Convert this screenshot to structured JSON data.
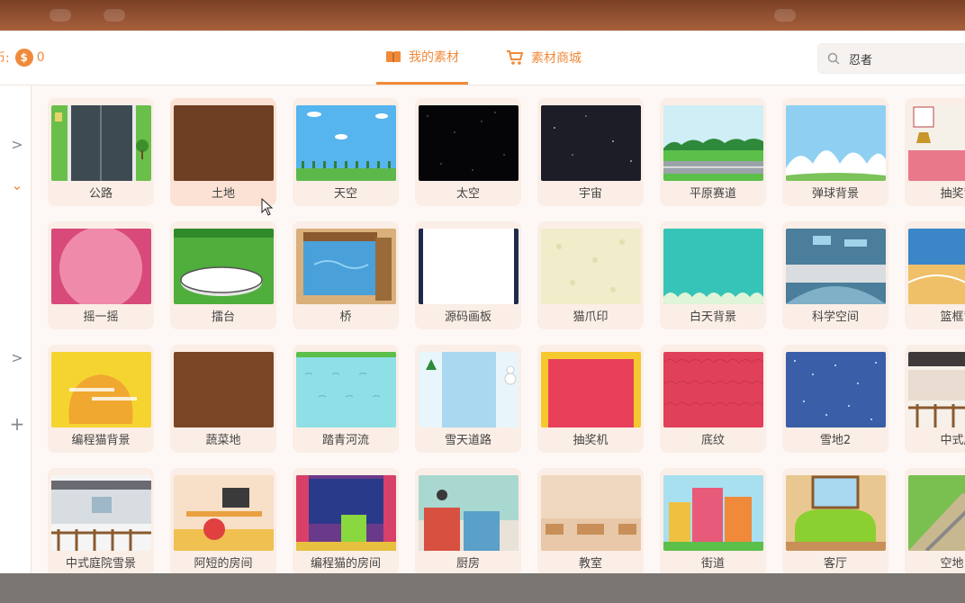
{
  "header": {
    "coin_prefix": "币:",
    "coin_symbol": "$",
    "coin_count": "0",
    "tabs": [
      {
        "label": "我的素材"
      },
      {
        "label": "素材商城"
      }
    ],
    "search": {
      "value": "忍者",
      "icon": "search-icon"
    }
  },
  "sidebar": {
    "controls": [
      ">",
      "⌄",
      ">",
      "+"
    ]
  },
  "colors": {
    "accent": "#f08a3a",
    "background": "#fdf8f5",
    "card": "#fbeee6"
  },
  "materials": [
    {
      "label": "公路"
    },
    {
      "label": "土地"
    },
    {
      "label": "天空"
    },
    {
      "label": "太空"
    },
    {
      "label": "宇宙"
    },
    {
      "label": "平原赛道"
    },
    {
      "label": "弹球背景"
    },
    {
      "label": "抽奖背"
    },
    {
      "label": "摇一摇"
    },
    {
      "label": "擂台"
    },
    {
      "label": "桥"
    },
    {
      "label": "源码画板"
    },
    {
      "label": "猫爪印"
    },
    {
      "label": "白天背景"
    },
    {
      "label": "科学空间"
    },
    {
      "label": "篮框背"
    },
    {
      "label": "编程猫背景"
    },
    {
      "label": "蔬菜地"
    },
    {
      "label": "踏青河流"
    },
    {
      "label": "雪天道路"
    },
    {
      "label": "抽奖机"
    },
    {
      "label": "底纹"
    },
    {
      "label": "雪地2"
    },
    {
      "label": "中式庭"
    },
    {
      "label": "中式庭院雪景"
    },
    {
      "label": "阿短的房间"
    },
    {
      "label": "编程猫的房间"
    },
    {
      "label": "厨房"
    },
    {
      "label": "教室"
    },
    {
      "label": "街道"
    },
    {
      "label": "客厅"
    },
    {
      "label": "空地台"
    }
  ]
}
